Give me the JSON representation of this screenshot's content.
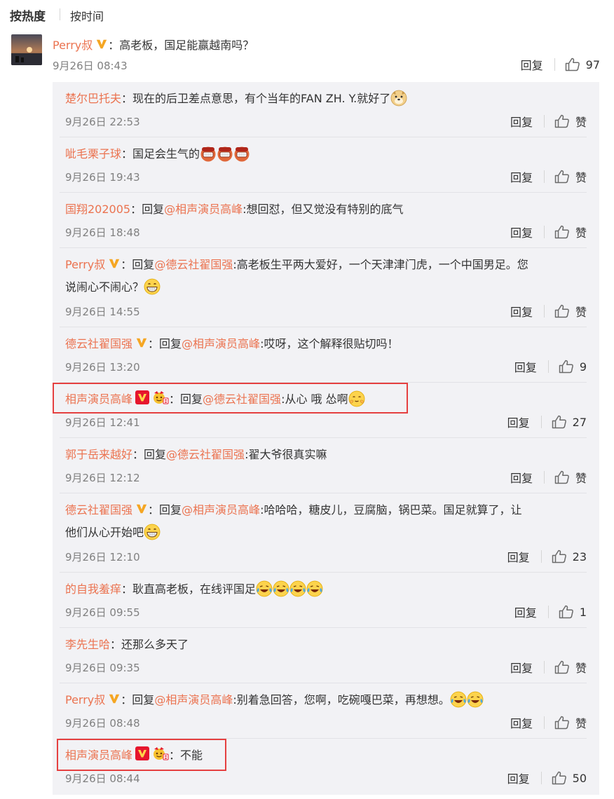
{
  "sort": {
    "hot": "按热度",
    "time": "按时间"
  },
  "main": {
    "name": "Perry叔",
    "text": "高老板，国足能赢越南吗？",
    "time": "9月26日 08:43",
    "reply": "回复",
    "likes": "97"
  },
  "replies": [
    {
      "name": "楚尔巴托夫",
      "prefix": "",
      "mention": "",
      "text": "现在的后卫差点意思，有个当年的FAN ZH. Y.就好了",
      "emoji": [
        "doge"
      ],
      "time": "9月26日 22:53",
      "reply": "回复",
      "likes": "赞"
    },
    {
      "name": "呲毛栗子球",
      "prefix": "",
      "mention": "",
      "text": "国足会生气的",
      "emoji": [
        "angry",
        "angry",
        "angry"
      ],
      "time": "9月26日 19:43",
      "reply": "回复",
      "likes": "赞"
    },
    {
      "name": "国翔202005",
      "prefix": "回复",
      "mention": "@相声演员高峰",
      "text": ":想回怼，但又觉没有特别的底气",
      "emoji": [],
      "time": "9月26日 18:48",
      "reply": "回复",
      "likes": "赞"
    },
    {
      "name": "Perry叔",
      "prefix": "回复",
      "mention": "@德云社翟国强",
      "text": ":高老板生平两大爱好，一个天津津门虎，一个中国男足。您",
      "text2": "说闹心不闹心？",
      "emoji": [
        "grin"
      ],
      "time": "9月26日 14:55",
      "reply": "回复",
      "likes": "赞"
    },
    {
      "name": "德云社翟国强",
      "prefix": "回复",
      "mention": "@相声演员高峰",
      "text": ":哎呀，这个解释很贴切吗！",
      "emoji": [],
      "time": "9月26日 13:20",
      "reply": "回复",
      "likes": "9"
    },
    {
      "name": "相声演员高峰",
      "prefix": "回复",
      "mention": "@德云社翟国强",
      "text": ":从心 哦 怂啊",
      "emoji": [
        "shy"
      ],
      "time": "9月26日 12:41",
      "reply": "回复",
      "likes": "27"
    },
    {
      "name": "郭于岳来越好",
      "prefix": "回复",
      "mention": "@德云社翟国强",
      "text": ":翟大爷很真实嘛",
      "emoji": [],
      "time": "9月26日 12:12",
      "reply": "回复",
      "likes": "赞"
    },
    {
      "name": "德云社翟国强",
      "prefix": "回复",
      "mention": "@相声演员高峰",
      "text": ":哈哈哈，糖皮儿，豆腐脑，锅巴菜。国足就算了，让",
      "text2": "他们从心开始吧",
      "emoji": [
        "grin"
      ],
      "time": "9月26日 12:10",
      "reply": "回复",
      "likes": "23"
    },
    {
      "name": "的自我羞痒",
      "prefix": "",
      "mention": "",
      "text": "耿直高老板，在线评国足",
      "emoji": [
        "laughcry",
        "laughcry",
        "laughcry",
        "laughcry"
      ],
      "time": "9月26日 09:55",
      "reply": "回复",
      "likes": "1"
    },
    {
      "name": "李先生哈",
      "prefix": "",
      "mention": "",
      "text": "还那么多天了",
      "emoji": [],
      "time": "9月26日 09:35",
      "reply": "回复",
      "likes": "赞"
    },
    {
      "name": "Perry叔",
      "prefix": "回复",
      "mention": "@相声演员高峰",
      "text": ":别着急回答，您啊，吃碗嘎巴菜，再想想。",
      "emoji": [
        "laughcry",
        "laughcry"
      ],
      "time": "9月26日 08:48",
      "reply": "回复",
      "likes": "赞"
    },
    {
      "name": "相声演员高峰",
      "prefix": "",
      "mention": "",
      "text": "不能",
      "emoji": [],
      "time": "9月26日 08:44",
      "reply": "回复",
      "likes": "50"
    }
  ],
  "colors": {
    "name": "#eb7350",
    "highlight": "#e54040",
    "vgold": "#f5a623",
    "vred": "#e6162d"
  }
}
